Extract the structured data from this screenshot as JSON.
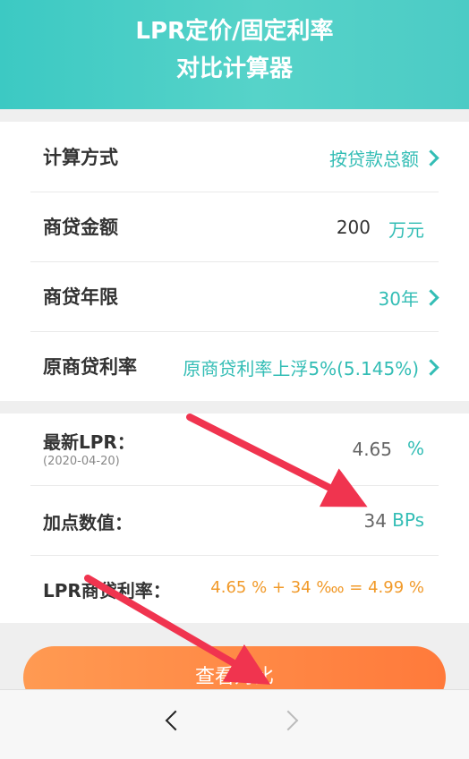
{
  "header": {
    "title_line1": "LPR定价/固定利率",
    "title_line2": "对比计算器"
  },
  "section1": {
    "rows": [
      {
        "label": "计算方式",
        "value": "按贷款总额"
      },
      {
        "label": "商贷金额",
        "value": "200",
        "unit": "万元"
      },
      {
        "label": "商贷年限",
        "value": "30年"
      },
      {
        "label": "原商贷利率",
        "value": "原商贷利率上浮5%(5.145%)"
      }
    ]
  },
  "section2": {
    "lpr": {
      "label": "最新LPR：",
      "date": "(2020-04-20)",
      "value": "4.65",
      "unit": "%"
    },
    "bps": {
      "label": "加点数值：",
      "value": "34",
      "unit": "BPs"
    },
    "rate": {
      "label": "LPR商贷利率：",
      "value": "4.65 % + 34 ‱ = 4.99 %"
    }
  },
  "button": {
    "label": "查看对比"
  },
  "colors": {
    "teal": "#33bdb5",
    "orange": "#f19a2a",
    "button": "#ff8a45",
    "arrow": "#f0344f"
  },
  "icons": {
    "back": "chevron-left-icon",
    "forward": "chevron-right-icon",
    "row_arrow": "chevron-right-icon"
  }
}
